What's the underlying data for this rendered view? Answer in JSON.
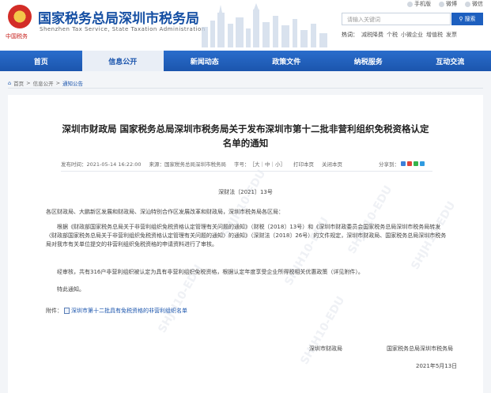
{
  "header": {
    "logo_text": "中国税务",
    "title": "国家税务总局深圳市税务局",
    "subtitle_en": "Shenzhen Tax Service, State Taxation Administration",
    "top_links": [
      "手机版",
      "微博",
      "微信"
    ],
    "search": {
      "placeholder": "请输入关键词",
      "button_label": "搜索"
    },
    "hot_words_label": "热词：",
    "hot_words": [
      "减税降费",
      "个税",
      "小微企业",
      "增值税",
      "发票"
    ]
  },
  "nav": {
    "items": [
      "首页",
      "信息公开",
      "新闻动态",
      "政策文件",
      "纳税服务",
      "互动交流"
    ],
    "active_index": 1
  },
  "breadcrumb": [
    "首页",
    "信息公开",
    "通知公告"
  ],
  "article": {
    "title_line1": "深圳市财政局 国家税务总局深圳市税务局关于发布深圳市第十二批非营利组织免税资格认定",
    "title_line2": "名单的通知",
    "meta": {
      "published": "发布时间：2021-05-14 16:22:00",
      "source": "来源：国家税务总局深圳市税务局",
      "font_size_label": "字号：",
      "font_sizes": "［大｜中｜小］",
      "print": "打印本页",
      "close": "关闭本页",
      "share": "分享到："
    },
    "doc_number": "深财法〔2021〕13号",
    "paragraphs": [
      "各区财政局、大鹏新区发展和财政局、深汕特别合作区发展改革和财政局，深圳市税务局各区局：",
      "根据《财政部国家税务总局关于非营利组织免税资格认定管理有关问题的通知》（财税〔2018〕13号）和《深圳市财政委员会国家税务总局深圳市税务局转发〈财政部国家税务总局关于非营利组织免税资格认定管理有关问题的通知〉的通知》（深财法〔2018〕26号）的文件规定，深圳市财政局、国家税务总局深圳市税务局对我市有关单位提交的非营利组织免税资格的申请资料进行了审核。",
      "经审核，共有316户非营利组织被认定为具有非营利组织免税资格，根据认定年度享受企业所得税相关优惠政策（详见附件）。",
      "特此通知。"
    ],
    "attachment_label": "附件：",
    "attachment_link": "深圳市第十二批具有免税资格的非营利组织名单",
    "signer1": "深圳市财政局",
    "signer2": "国家税务总局深圳市税务局",
    "date": "2021年5月13日"
  },
  "watermark_text": "SHJH10-EDU",
  "colors": {
    "brand_blue": "#1b55ad",
    "title_blue": "#154fa3",
    "logo_red": "#c7211d"
  }
}
